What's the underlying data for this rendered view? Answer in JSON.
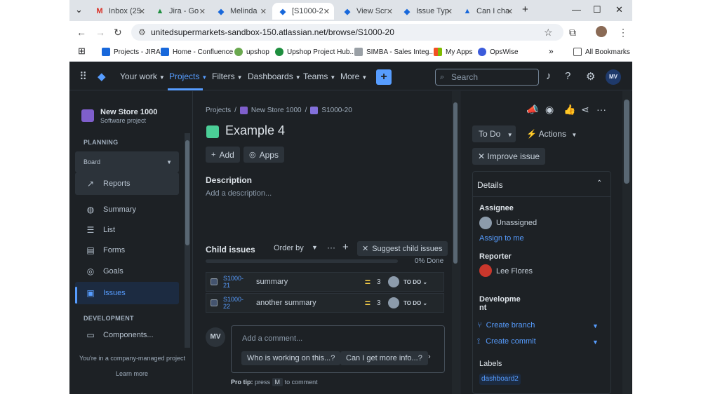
{
  "browser": {
    "tabs": [
      {
        "label": "Inbox (25",
        "icon": "gmail-icon"
      },
      {
        "label": "Jira - Go",
        "icon": "drive-icon"
      },
      {
        "label": "Melinda",
        "icon": "jira-icon"
      },
      {
        "label": "[S1000-2",
        "icon": "jira-icon"
      },
      {
        "label": "View Scr",
        "icon": "jira-icon"
      },
      {
        "label": "Issue Typ",
        "icon": "jira-icon"
      },
      {
        "label": "Can I cha",
        "icon": "atlassian-icon"
      }
    ],
    "url": "unitedsupermarkets-sandbox-150.atlassian.net/browse/S1000-20",
    "bookmarks": [
      "Projects - JIRA",
      "Home - Confluence",
      "upshop",
      "Upshop Project Hub...",
      "SIMBA - Sales Integ...",
      "My Apps",
      "OpsWise"
    ],
    "all_bookmarks": "All Bookmarks",
    "more_bookmarks": "»"
  },
  "jira_nav": {
    "your_work": "Your work",
    "projects": "Projects",
    "filters": "Filters",
    "dashboards": "Dashboards",
    "teams": "Teams",
    "more": "More",
    "create": "+",
    "search_placeholder": "Search",
    "avatar": "MV"
  },
  "sidebar": {
    "project_name": "New Store 1000",
    "project_type": "Software project",
    "planning_label": "PLANNING",
    "board": "Board",
    "reports": "Reports",
    "items": [
      "Summary",
      "List",
      "Forms",
      "Goals",
      "Issues"
    ],
    "development_label": "DEVELOPMENT",
    "components": "Components...",
    "footer": "You're in a company-managed project",
    "learn_more": "Learn more"
  },
  "main": {
    "breadcrumb": {
      "projects": "Projects",
      "sep": "/",
      "project": "New Store 1000",
      "issue": "S1000-20"
    },
    "title": "Example 4",
    "add_button": "Add",
    "apps_button": "Apps",
    "description_label": "Description",
    "description_placeholder": "Add a description...",
    "child_issues_label": "Child issues",
    "order_by": "Order by",
    "suggest_button": "Suggest child issues",
    "progress_done_fraction": 0,
    "progress_label": "0% Done",
    "child_issues": [
      {
        "key": "S1000-21",
        "summary": "summary",
        "points": "3",
        "status": "TO DO"
      },
      {
        "key": "S1000-22",
        "summary": "another summary",
        "points": "3",
        "status": "TO DO"
      }
    ],
    "comment": {
      "avatar": "MV",
      "placeholder": "Add a comment...",
      "suggestions": [
        "Who is working on this...?",
        "Can I get more info...?"
      ],
      "pro_tip_label": "Pro tip:",
      "pro_tip_press": "press",
      "pro_tip_key": "M",
      "pro_tip_rest": "to comment"
    }
  },
  "right_panel": {
    "status": "To Do",
    "actions": "Actions",
    "improve": "Improve issue",
    "details_title": "Details",
    "assignee_label": "Assignee",
    "assignee_value": "Unassigned",
    "assign_to_me": "Assign to me",
    "reporter_label": "Reporter",
    "reporter_value": "Lee Flores",
    "development_label_1": "Developme",
    "development_label_2": "nt",
    "create_branch": "Create branch",
    "create_commit": "Create commit",
    "labels_label": "Labels",
    "label_value": "dashboard2"
  },
  "colors": {
    "accent": "#579dff",
    "bg": "#1d2125",
    "title_icon": "#4bce97",
    "priority": "#f5cd47"
  }
}
